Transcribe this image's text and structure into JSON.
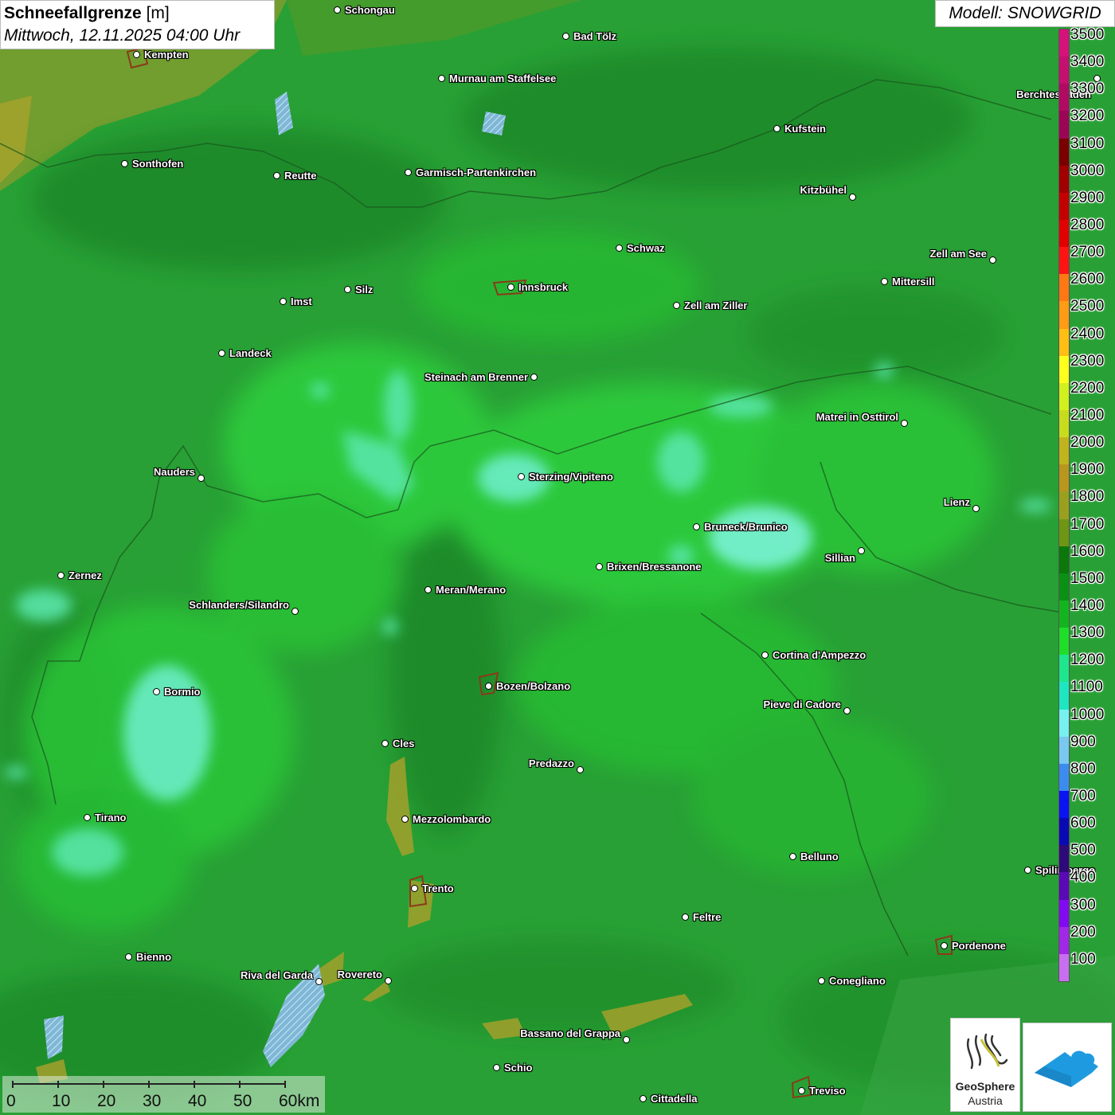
{
  "header": {
    "title_bold": "Schneefallgrenze",
    "title_unit": "[m]",
    "datetime": "Mittwoch, 12.11.2025 04:00 Uhr"
  },
  "model": {
    "label": "Modell: SNOWGRID"
  },
  "cities": [
    {
      "name": "Schongau",
      "label_side": "right"
    },
    {
      "name": "Bad Tölz",
      "label_side": "right"
    },
    {
      "name": "Kempten",
      "label_side": "right"
    },
    {
      "name": "Murnau am Staffelsee",
      "label_side": "right"
    },
    {
      "name": "Berchtesgaden",
      "label_side": "left"
    },
    {
      "name": "Kufstein",
      "label_side": "right"
    },
    {
      "name": "Sonthofen",
      "label_side": "right"
    },
    {
      "name": "Reutte",
      "label_side": "right"
    },
    {
      "name": "Garmisch-Partenkirchen",
      "label_side": "right"
    },
    {
      "name": "Kitzbühel",
      "label_side": "left"
    },
    {
      "name": "Schwaz",
      "label_side": "right"
    },
    {
      "name": "Zell am See",
      "label_side": "left"
    },
    {
      "name": "Innsbruck",
      "label_side": "right"
    },
    {
      "name": "Mittersill",
      "label_side": "right"
    },
    {
      "name": "Imst",
      "label_side": "right"
    },
    {
      "name": "Silz",
      "label_side": "right"
    },
    {
      "name": "Zell am Ziller",
      "label_side": "right"
    },
    {
      "name": "Landeck",
      "label_side": "right"
    },
    {
      "name": "Steinach am Brenner",
      "label_side": "left"
    },
    {
      "name": "Matrei in Osttirol",
      "label_side": "left"
    },
    {
      "name": "Nauders",
      "label_side": "left"
    },
    {
      "name": "Sterzing/Vipiteno",
      "label_side": "right"
    },
    {
      "name": "Lienz",
      "label_side": "left"
    },
    {
      "name": "Bruneck/Brunico",
      "label_side": "right"
    },
    {
      "name": "Sillian",
      "label_side": "left"
    },
    {
      "name": "Brixen/Bressanone",
      "label_side": "right"
    },
    {
      "name": "Zernez",
      "label_side": "right"
    },
    {
      "name": "Meran/Merano",
      "label_side": "right"
    },
    {
      "name": "Schlanders/Silandro",
      "label_side": "left"
    },
    {
      "name": "Cortina d'Ampezzo",
      "label_side": "right"
    },
    {
      "name": "Bozen/Bolzano",
      "label_side": "right"
    },
    {
      "name": "Bormio",
      "label_side": "right"
    },
    {
      "name": "Pieve di Cadore",
      "label_side": "left"
    },
    {
      "name": "Cles",
      "label_side": "right"
    },
    {
      "name": "Predazzo",
      "label_side": "left"
    },
    {
      "name": "Tirano",
      "label_side": "right"
    },
    {
      "name": "Mezzolombardo",
      "label_side": "right"
    },
    {
      "name": "Belluno",
      "label_side": "right"
    },
    {
      "name": "Spilimbergo",
      "label_side": "right"
    },
    {
      "name": "Trento",
      "label_side": "right"
    },
    {
      "name": "Feltre",
      "label_side": "right"
    },
    {
      "name": "Pordenone",
      "label_side": "right"
    },
    {
      "name": "Bienno",
      "label_side": "right"
    },
    {
      "name": "Riva del Garda",
      "label_side": "left"
    },
    {
      "name": "Rovereto",
      "label_side": "left"
    },
    {
      "name": "Conegliano",
      "label_side": "right"
    },
    {
      "name": "Bassano del Grappa",
      "label_side": "left"
    },
    {
      "name": "Schio",
      "label_side": "right"
    },
    {
      "name": "Treviso",
      "label_side": "right"
    },
    {
      "name": "Cittadella",
      "label_side": "right"
    }
  ],
  "legend": {
    "items": [
      {
        "label": "3500",
        "color": "#d4127a"
      },
      {
        "label": "3400",
        "color": "#c4106e"
      },
      {
        "label": "3300",
        "color": "#b00a63"
      },
      {
        "label": "3200",
        "color": "#9a0655"
      },
      {
        "label": "3100",
        "color": "#7a0000"
      },
      {
        "label": "3000",
        "color": "#a00000"
      },
      {
        "label": "2900",
        "color": "#c20000"
      },
      {
        "label": "2800",
        "color": "#e00000"
      },
      {
        "label": "2700",
        "color": "#ff1414"
      },
      {
        "label": "2600",
        "color": "#ff7814"
      },
      {
        "label": "2500",
        "color": "#ff9b14"
      },
      {
        "label": "2400",
        "color": "#ffbe14"
      },
      {
        "label": "2300",
        "color": "#ffff1e"
      },
      {
        "label": "2200",
        "color": "#d2f01e"
      },
      {
        "label": "2100",
        "color": "#c8dc1e"
      },
      {
        "label": "2000",
        "color": "#c0b41e"
      },
      {
        "label": "1900",
        "color": "#b9961e"
      },
      {
        "label": "1800",
        "color": "#9aa01e"
      },
      {
        "label": "1700",
        "color": "#6e9614"
      },
      {
        "label": "1600",
        "color": "#0a780a"
      },
      {
        "label": "1500",
        "color": "#0a9114"
      },
      {
        "label": "1400",
        "color": "#14b41e"
      },
      {
        "label": "1300",
        "color": "#1ede28"
      },
      {
        "label": "1200",
        "color": "#1ee68c"
      },
      {
        "label": "1100",
        "color": "#1ee6c0"
      },
      {
        "label": "1000",
        "color": "#78f0f0"
      },
      {
        "label": "900",
        "color": "#78c8f0"
      },
      {
        "label": "800",
        "color": "#3c8cf0"
      },
      {
        "label": "700",
        "color": "#0a14f0"
      },
      {
        "label": "600",
        "color": "#0a0ab4"
      },
      {
        "label": "500",
        "color": "#2d0a78"
      },
      {
        "label": "400",
        "color": "#5a0ab4"
      },
      {
        "label": "300",
        "color": "#820af0"
      },
      {
        "label": "200",
        "color": "#a028e6"
      },
      {
        "label": "100",
        "color": "#c86ef0"
      }
    ]
  },
  "scalebar": {
    "ticks": [
      "0",
      "10",
      "20",
      "30",
      "40",
      "50",
      "60km"
    ]
  },
  "logos": {
    "geosphere_line1": "GeoSphere",
    "geosphere_line2": "Austria"
  }
}
